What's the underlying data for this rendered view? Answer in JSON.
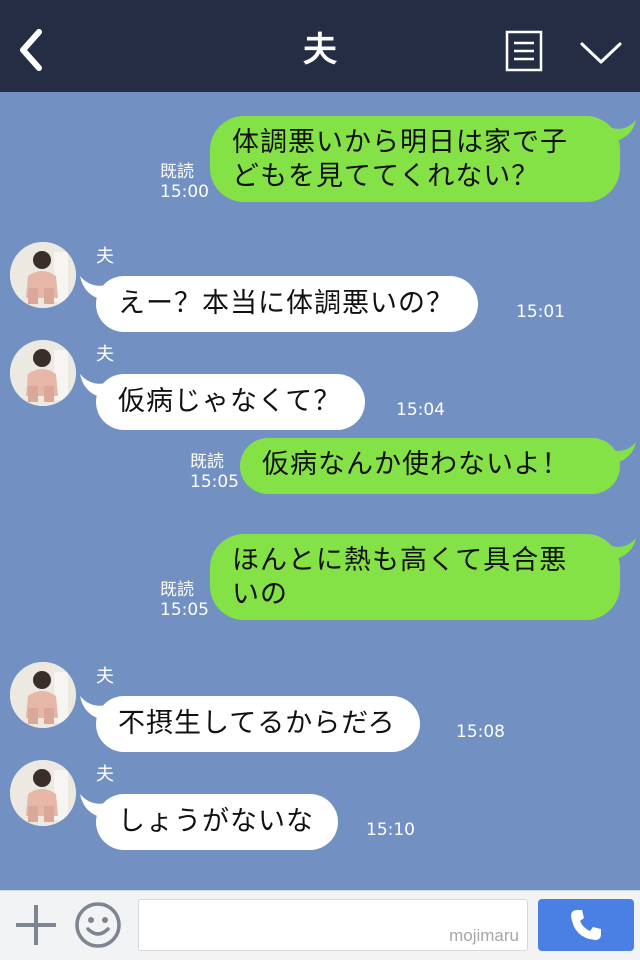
{
  "header": {
    "title": "夫"
  },
  "messages": [
    {
      "type": "out",
      "text_lines": [
        "体調悪いから明日は家で子",
        "どもを見ててくれない？"
      ],
      "read_label": "既読",
      "time": "15:00"
    },
    {
      "type": "in",
      "sender": "夫",
      "text": "えー？本当に体調悪いの？",
      "time": "15:01"
    },
    {
      "type": "in",
      "sender": "夫",
      "text": "仮病じゃなくて？",
      "time": "15:04"
    },
    {
      "type": "out",
      "text_lines": [
        "仮病なんか使わないよ！"
      ],
      "read_label": "既読",
      "time": "15:05"
    },
    {
      "type": "out",
      "text_lines": [
        "ほんとに熱も高くて具合悪",
        "いの"
      ],
      "read_label": "既読",
      "time": "15:05"
    },
    {
      "type": "in",
      "sender": "夫",
      "text": "不摂生してるからだろ",
      "time": "15:08"
    },
    {
      "type": "in",
      "sender": "夫",
      "text": "しょうがないな",
      "time": "15:10"
    }
  ],
  "input": {
    "watermark": "mojimaru",
    "value": ""
  },
  "icons": {
    "back": "chevron-left-icon",
    "menu": "menu-list-icon",
    "collapse": "chevron-down-icon",
    "add": "plus-icon",
    "emoji": "smiley-icon",
    "call": "phone-icon"
  },
  "colors": {
    "header_bg": "#242d44",
    "chat_bg": "#7290c1",
    "outgoing_bubble": "#84e247",
    "incoming_bubble": "#ffffff",
    "call_button": "#4a7fe4"
  }
}
